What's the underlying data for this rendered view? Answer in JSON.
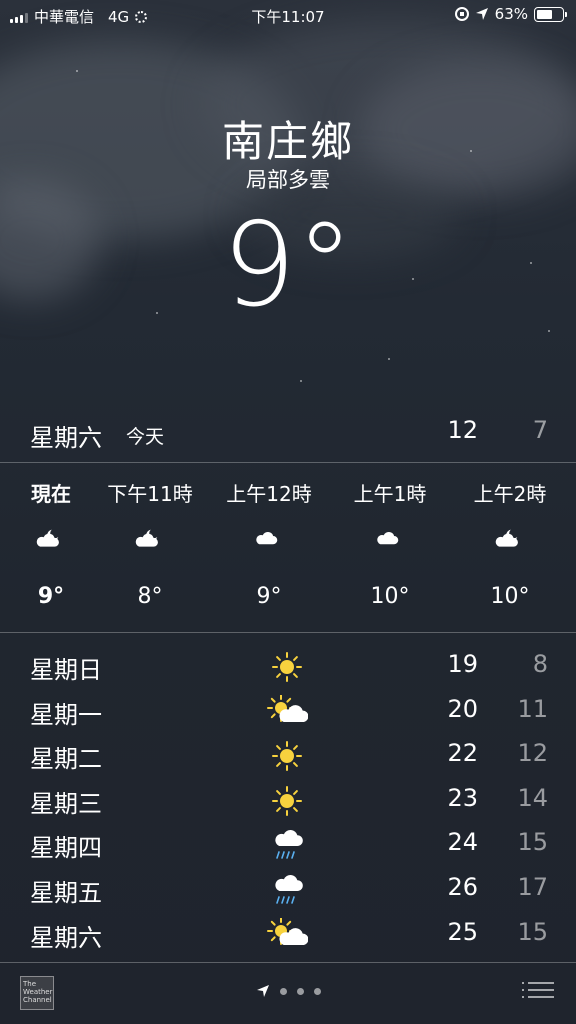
{
  "status_bar": {
    "carrier": "中華電信",
    "network": "4G",
    "time": "下午11:07",
    "battery": "63%",
    "battery_level": 0.63
  },
  "location": {
    "city": "南庄鄉",
    "condition": "局部多雲",
    "temperature": "9°"
  },
  "today": {
    "day": "星期六",
    "label": "今天",
    "high": "12",
    "low": "7"
  },
  "hourly": [
    {
      "time": "現在",
      "icon": "partly-cloudy-night-icon",
      "temp": "9°"
    },
    {
      "time": "下午11時",
      "icon": "partly-cloudy-night-icon",
      "temp": "8°"
    },
    {
      "time": "上午12時",
      "icon": "cloud-icon",
      "temp": "9°"
    },
    {
      "time": "上午1時",
      "icon": "cloud-icon",
      "temp": "10°"
    },
    {
      "time": "上午2時",
      "icon": "partly-cloudy-night-icon",
      "temp": "10°"
    }
  ],
  "daily": [
    {
      "day": "星期日",
      "icon": "sun-icon",
      "high": "19",
      "low": "8"
    },
    {
      "day": "星期一",
      "icon": "partly-sunny-icon",
      "high": "20",
      "low": "11"
    },
    {
      "day": "星期二",
      "icon": "sun-icon",
      "high": "22",
      "low": "12"
    },
    {
      "day": "星期三",
      "icon": "sun-icon",
      "high": "23",
      "low": "14"
    },
    {
      "day": "星期四",
      "icon": "rain-icon",
      "high": "24",
      "low": "15"
    },
    {
      "day": "星期五",
      "icon": "rain-icon",
      "high": "26",
      "low": "17"
    },
    {
      "day": "星期六",
      "icon": "partly-sunny-icon",
      "high": "25",
      "low": "15"
    }
  ],
  "footer": {
    "logo_text": "The Weather Channel",
    "page_count": 4,
    "current_page": 1
  },
  "colors": {
    "sun": "#f7d23e",
    "cloud": "#ffffff",
    "rain": "#5ab0f0",
    "dim_text": "rgba(255,255,255,0.55)"
  }
}
